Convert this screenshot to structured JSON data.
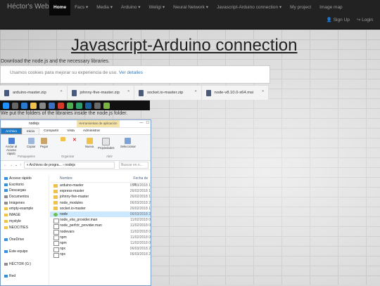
{
  "navbar": {
    "brand": "Héctor's WebSite",
    "items": [
      {
        "label": "Home",
        "active": true
      },
      {
        "label": "Facs ▾"
      },
      {
        "label": "Media ▾"
      },
      {
        "label": "Arduino ▾"
      },
      {
        "label": "Weligi ▾"
      },
      {
        "label": "Neural Network ▾"
      },
      {
        "label": "Javascript-Arduino connection ▾"
      },
      {
        "label": "My project"
      },
      {
        "label": "Image map"
      }
    ],
    "signup": "Sign Up",
    "login": "Login"
  },
  "page": {
    "title": "Javascript-Arduino connection",
    "intro": "Download the node.js and the necessary libraries.",
    "after": "We put the folders of the libraries inside the node.js folder."
  },
  "cookie": {
    "text": "Usamos cookies para mejorar su experiencia de uso.",
    "link": "Ver detalles"
  },
  "downloads": [
    "arduino-master.zip",
    "johnny-five-master.zip",
    "socket.io-master.zip",
    "node-v8.10.0-x64.msi"
  ],
  "explorer": {
    "title": "nodejs",
    "tool_heading": "Herramientas de aplicación",
    "tabs": [
      "Archivo",
      "Inicio",
      "Compartir",
      "Vista",
      "Administrar"
    ],
    "ribbon": {
      "pin": "Anclar al Acceso rápido",
      "copy": "Copiar",
      "paste": "Pegar",
      "move": "Mover a",
      "delete": "Eliminar",
      "rename": "Cambiar nombre",
      "new": "Nueva carpeta",
      "properties": "Propiedades",
      "open": "Abrir",
      "select": "Seleccionar",
      "groups": [
        "Portapapeles",
        "Organizar",
        "Nuevo",
        "Abrir"
      ]
    },
    "path": [
      "Archivos de progra...",
      "nodejs"
    ],
    "search_placeholder": "Buscar en n...",
    "columns": [
      "Nombre",
      "Fecha de m"
    ],
    "nav": [
      {
        "label": "Acceso rápido",
        "kind": "blue"
      },
      {
        "label": "Escritorio",
        "kind": "blue"
      },
      {
        "label": "Descargas",
        "kind": "blue"
      },
      {
        "label": "Documentos",
        "kind": "gray"
      },
      {
        "label": "Imágenes",
        "kind": "gray"
      },
      {
        "label": "empty-example",
        "kind": "folder"
      },
      {
        "label": "IMAGE",
        "kind": "folder"
      },
      {
        "label": "mystyle",
        "kind": "folder"
      },
      {
        "label": "NEOCITIES",
        "kind": "folder"
      },
      {
        "label": "",
        "kind": "none"
      },
      {
        "label": "OneDrive",
        "kind": "blue"
      },
      {
        "label": "",
        "kind": "none"
      },
      {
        "label": "Este equipo",
        "kind": "blue"
      },
      {
        "label": "",
        "kind": "none"
      },
      {
        "label": "HÉCTOR (G:)",
        "kind": "gray"
      },
      {
        "label": "",
        "kind": "none"
      },
      {
        "label": "Red",
        "kind": "blue"
      }
    ],
    "files": [
      {
        "name": "arduino-master",
        "date": "05/03/2018 1",
        "kind": "folder"
      },
      {
        "name": "express-master",
        "date": "26/02/2018 1",
        "kind": "folder"
      },
      {
        "name": "johnny-five-master",
        "date": "26/02/2018 1",
        "kind": "folder"
      },
      {
        "name": "node_modules",
        "date": "06/03/2018 2",
        "kind": "folder"
      },
      {
        "name": "socket.io-master",
        "date": "26/02/2018 1",
        "kind": "folder"
      },
      {
        "name": "node",
        "date": "06/03/2018 2",
        "kind": "node",
        "selected": true
      },
      {
        "name": "node_etw_provider.man",
        "date": "11/02/2018 0",
        "kind": "file"
      },
      {
        "name": "node_perfctr_provider.man",
        "date": "11/02/2018 0",
        "kind": "file"
      },
      {
        "name": "nodevars",
        "date": "11/02/2018 0",
        "kind": "file"
      },
      {
        "name": "npm",
        "date": "11/02/2018 0",
        "kind": "file"
      },
      {
        "name": "npm",
        "date": "11/02/2018 0",
        "kind": "file"
      },
      {
        "name": "npx",
        "date": "06/03/2018 2",
        "kind": "file"
      },
      {
        "name": "npx",
        "date": "06/03/2018 2",
        "kind": "file"
      }
    ]
  }
}
